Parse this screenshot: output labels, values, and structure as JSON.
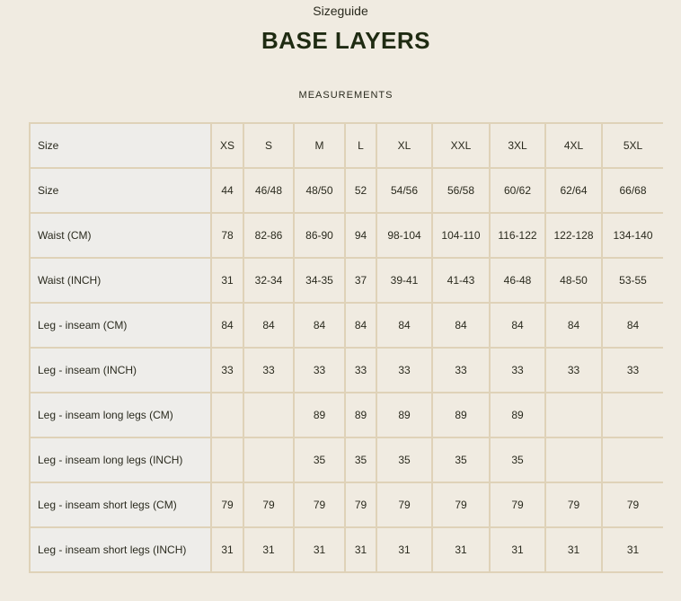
{
  "header": {
    "supertitle": "Sizeguide",
    "title": "BASE LAYERS",
    "section_label": "MEASUREMENTS"
  },
  "table": {
    "header_label": "Size",
    "sizes": [
      "XS",
      "S",
      "M",
      "L",
      "XL",
      "XXL",
      "3XL",
      "4XL",
      "5XL"
    ],
    "rows": [
      {
        "label": "Size",
        "cells": [
          "44",
          "46/48",
          "48/50",
          "52",
          "54/56",
          "56/58",
          "60/62",
          "62/64",
          "66/68"
        ]
      },
      {
        "label": "Waist (CM)",
        "cells": [
          "78",
          "82-86",
          "86-90",
          "94",
          "98-104",
          "104-110",
          "116-122",
          "122-128",
          "134-140"
        ]
      },
      {
        "label": "Waist (INCH)",
        "cells": [
          "31",
          "32-34",
          "34-35",
          "37",
          "39-41",
          "41-43",
          "46-48",
          "48-50",
          "53-55"
        ]
      },
      {
        "label": "Leg - inseam (CM)",
        "cells": [
          "84",
          "84",
          "84",
          "84",
          "84",
          "84",
          "84",
          "84",
          "84"
        ]
      },
      {
        "label": "Leg - inseam (INCH)",
        "cells": [
          "33",
          "33",
          "33",
          "33",
          "33",
          "33",
          "33",
          "33",
          "33"
        ]
      },
      {
        "label": "Leg - inseam long legs (CM)",
        "cells": [
          "",
          "",
          "89",
          "89",
          "89",
          "89",
          "89",
          "",
          ""
        ]
      },
      {
        "label": "Leg - inseam long legs (INCH)",
        "cells": [
          "",
          "",
          "35",
          "35",
          "35",
          "35",
          "35",
          "",
          ""
        ]
      },
      {
        "label": "Leg - inseam short legs (CM)",
        "cells": [
          "79",
          "79",
          "79",
          "79",
          "79",
          "79",
          "79",
          "79",
          "79"
        ]
      },
      {
        "label": "Leg - inseam short legs (INCH)",
        "cells": [
          "31",
          "31",
          "31",
          "31",
          "31",
          "31",
          "31",
          "31",
          "31"
        ]
      }
    ]
  }
}
